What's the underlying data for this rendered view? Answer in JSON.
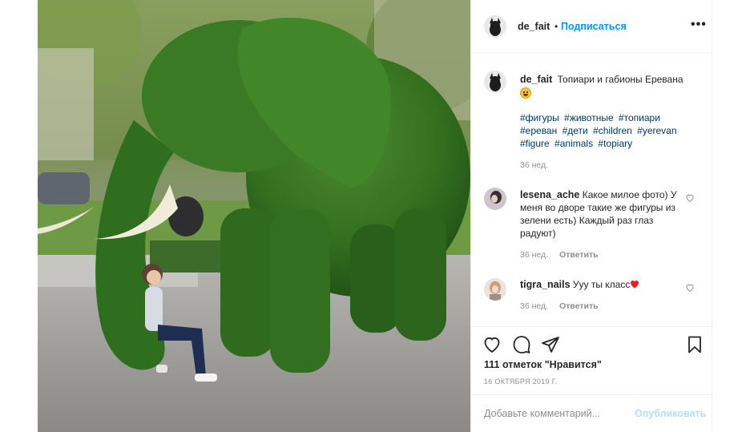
{
  "post": {
    "username": "de_fait",
    "follow_label": "Подписаться",
    "dot": "•",
    "more_label": "•••",
    "image_icon": "elephant-topiary-photo"
  },
  "caption": {
    "username": "de_fait",
    "text": "Топиари и габионы Еревана",
    "emoji": "grinning-face-emoji",
    "hashtags": [
      "#фигуры",
      "#животные",
      "#топиари",
      "#ереван",
      "#дети",
      "#children",
      "#yerevan",
      "#figure",
      "#animals",
      "#topiary"
    ],
    "time": "36 нед."
  },
  "comments": [
    {
      "username": "lesena_ache",
      "text": "Какое милое фото) У меня во дворе такие же фигуры из зелени есть) Каждый раз глаз радуют)",
      "time": "36 нед.",
      "reply": "Ответить"
    },
    {
      "username": "tigra_nails",
      "text": "Ууу ты класс",
      "emoji": "red-heart-emoji",
      "time": "36 нед.",
      "reply": "Ответить"
    }
  ],
  "actions": {
    "like_icon": "heart-icon",
    "comment_icon": "comment-icon",
    "share_icon": "share-icon",
    "save_icon": "bookmark-icon",
    "likes_text": "111 отметок \"Нравится\"",
    "date": "16 ОКТЯБРЯ 2019 Г."
  },
  "add_comment": {
    "placeholder": "Добавьте комментарий...",
    "publish_label": "Опубликовать"
  },
  "colors": {
    "link_blue": "#0095f6",
    "hashtag": "#00376b",
    "muted": "#8e8e8e",
    "publish_disabled": "#b2dffc",
    "heart_red": "#ed4956"
  }
}
